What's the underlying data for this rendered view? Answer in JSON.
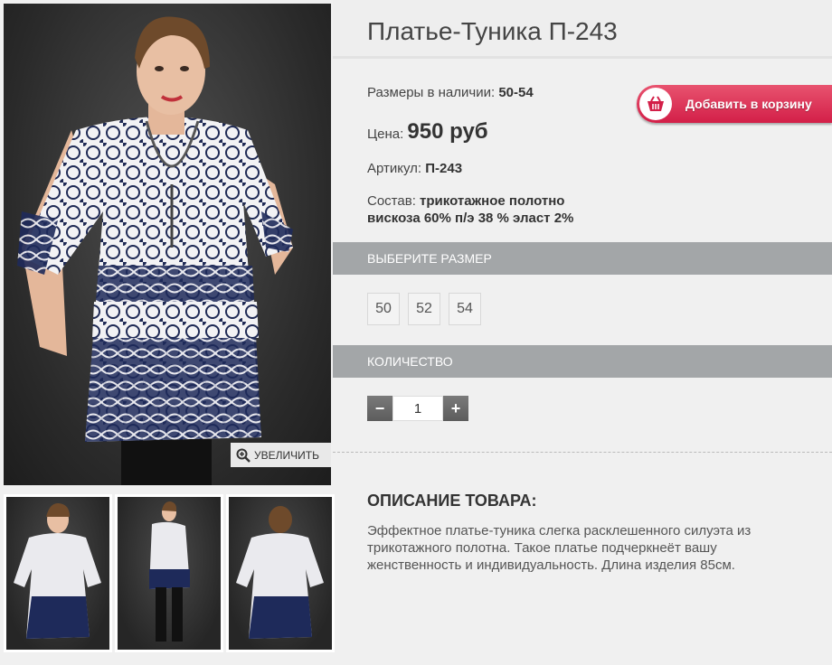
{
  "product": {
    "title": "Платье-Туника П-243",
    "sizes_label": "Размеры в наличии:",
    "sizes_value": "50-54",
    "price_label": "Цена:",
    "price_value": "950 руб",
    "sku_label": "Артикул:",
    "sku_value": "П-243",
    "composition_label": "Состав:",
    "composition_line1": "трикотажное полотно",
    "composition_line2": "вискоза 60% п/э 38 % эласт 2%"
  },
  "cart": {
    "label": "Добавить в корзину",
    "icon": "basket-icon",
    "color": "#d31f48"
  },
  "gallery": {
    "zoom_label": "УВЕЛИЧИТЬ",
    "zoom_icon": "zoom-in-icon"
  },
  "size_section": {
    "header": "ВЫБЕРИТЕ РАЗМЕР",
    "options": [
      "50",
      "52",
      "54"
    ]
  },
  "qty_section": {
    "header": "КОЛИЧЕСТВО",
    "value": "1",
    "minus": "−",
    "plus": "+"
  },
  "description": {
    "title": "ОПИСАНИЕ ТОВАРА:",
    "text": "Эффектное платье-туника слегка расклешенного силуэта из трикотажного полотна. Такое платье подчеркнеёт вашу женственность и индивидуальность. Длина изделия 85см."
  }
}
